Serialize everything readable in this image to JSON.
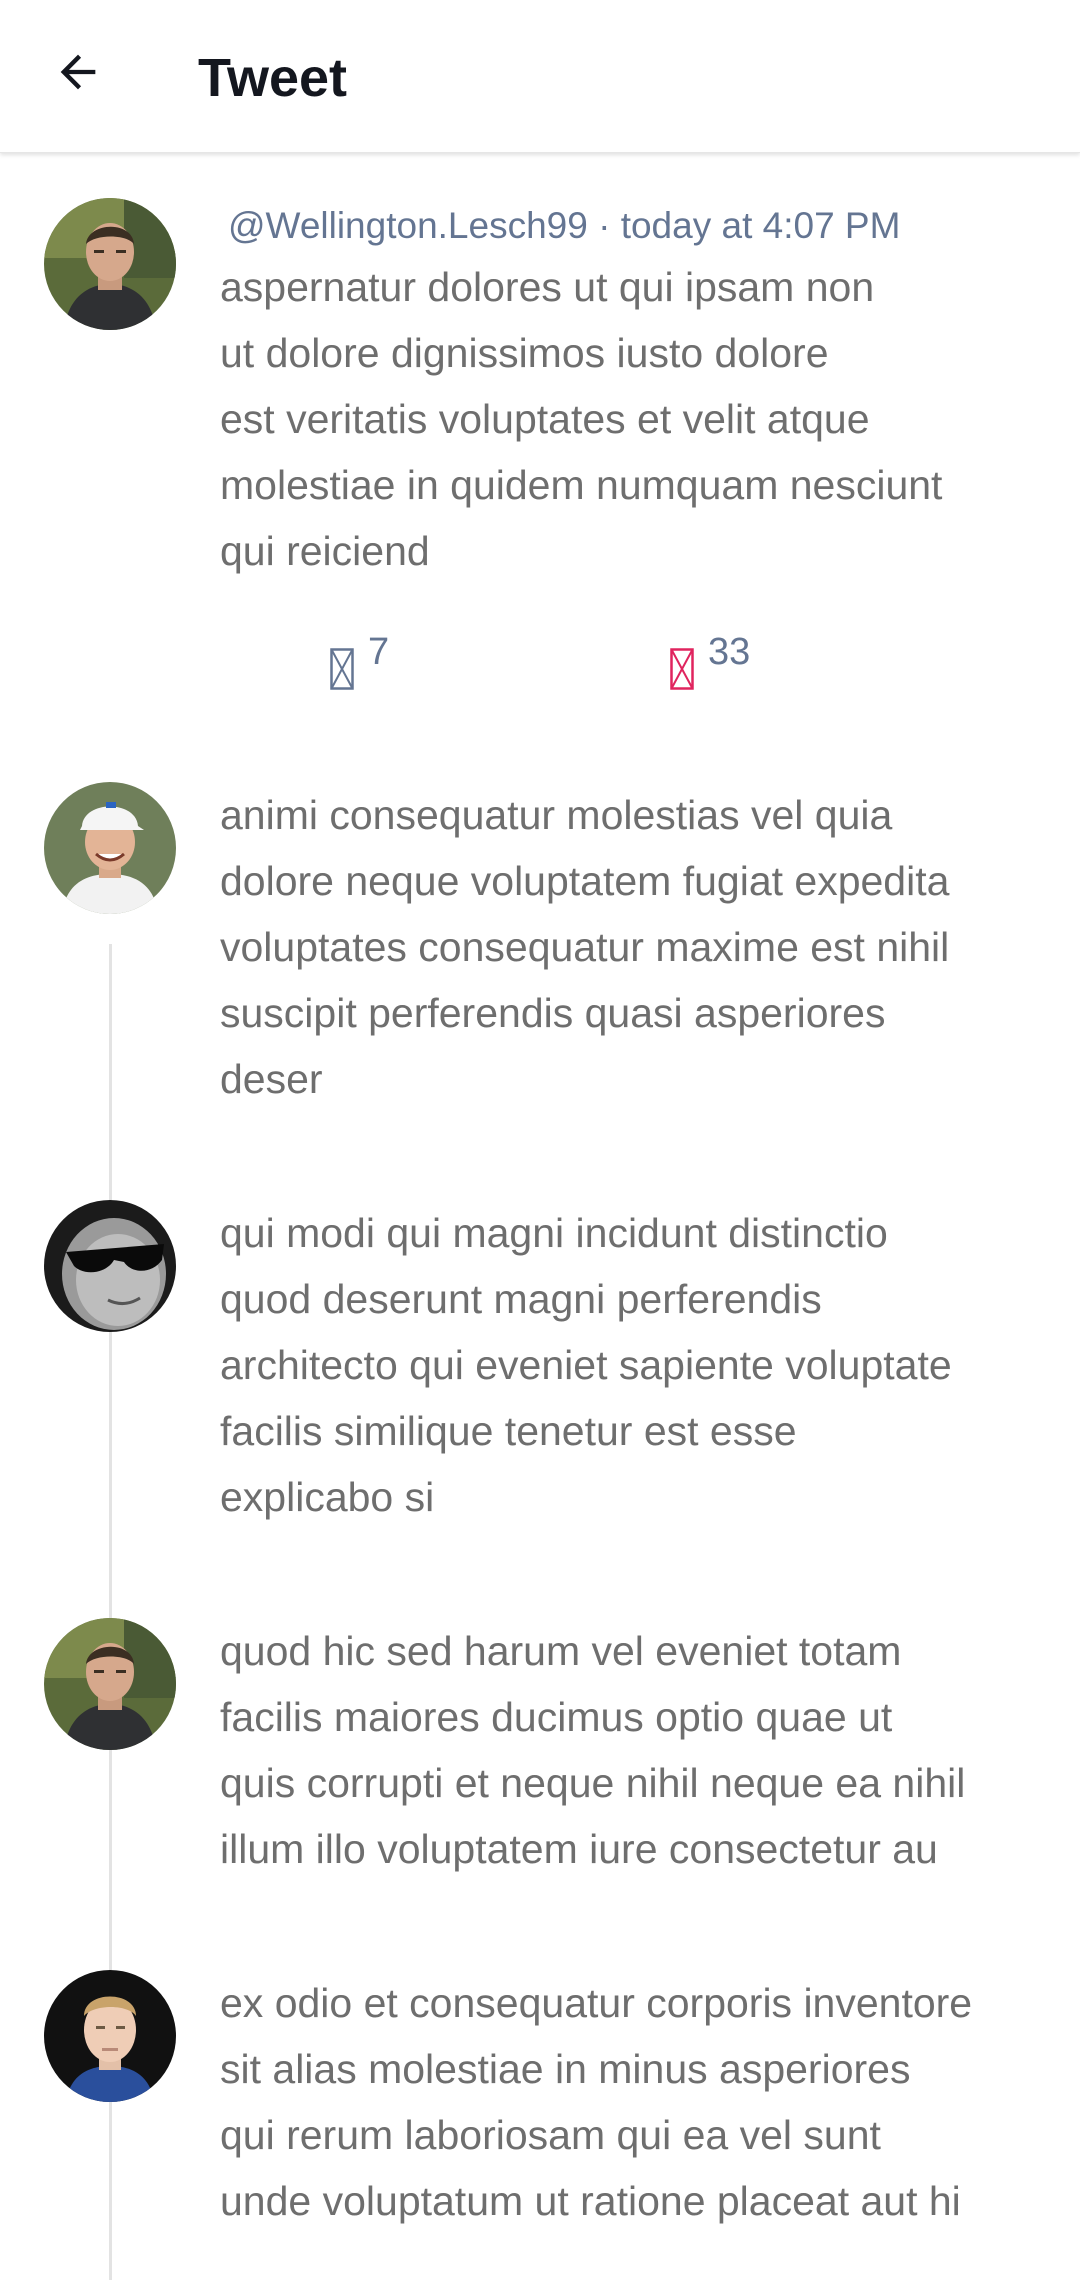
{
  "header": {
    "title": "Tweet"
  },
  "tweet": {
    "handle": "@Wellington.Lesch99",
    "separator": "·",
    "timestamp": "today at 4:07 PM",
    "lines": [
      "aspernatur dolores ut qui ipsam non",
      "ut dolore dignissimos iusto dolore",
      "est veritatis voluptates et velit atque",
      "molestiae in quidem numquam nesciunt",
      "qui reiciend"
    ],
    "reply_count": "7",
    "like_count": "33"
  },
  "replies": [
    {
      "lines": [
        "animi consequatur molestias vel quia",
        "dolore neque voluptatem fugiat expedita",
        "voluptates consequatur maxime est nihil",
        "suscipit perferendis quasi asperiores",
        "deser"
      ]
    },
    {
      "lines": [
        "qui modi qui magni incidunt distinctio",
        "quod deserunt magni perferendis",
        "architecto qui eveniet sapiente voluptate",
        "facilis similique tenetur est esse",
        "explicabo si"
      ]
    },
    {
      "lines": [
        "quod hic sed harum vel eveniet totam",
        "facilis maiores ducimus optio quae ut",
        "quis corrupti et neque nihil neque ea nihil",
        "illum illo voluptatem iure consectetur au"
      ]
    },
    {
      "lines": [
        "ex odio et consequatur corporis inventore",
        "sit alias molestiae in minus asperiores",
        "qui rerum laboriosam qui ea vel sunt",
        "unde voluptatum ut ratione placeat aut hi"
      ]
    }
  ],
  "colors": {
    "title": "#14171f",
    "meta": "#647592",
    "body_text": "#6e6e6e",
    "like_accent": "#e0245e",
    "thread_line": "#e3e3e3"
  },
  "icons": {
    "back": "arrow-left-icon",
    "reply": "reply-icon",
    "like": "heart-icon"
  }
}
